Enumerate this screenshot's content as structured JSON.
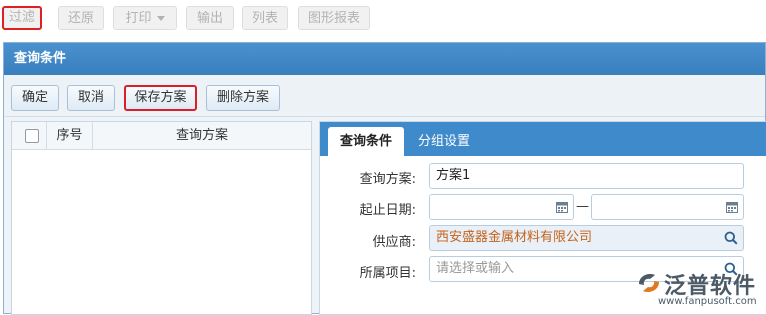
{
  "toolbar": {
    "filter": "过滤",
    "restore": "还原",
    "print": "打印",
    "export": "输出",
    "list": "列表",
    "chart_report": "图形报表"
  },
  "dialog": {
    "title": "查询条件",
    "buttons": {
      "confirm": "确定",
      "cancel": "取消",
      "save_scheme": "保存方案",
      "delete_scheme": "删除方案"
    },
    "scheme_table": {
      "columns": [
        "序号",
        "查询方案"
      ]
    },
    "tabs": {
      "conditions": "查询条件",
      "grouping": "分组设置"
    },
    "form": {
      "scheme_label": "查询方案:",
      "scheme_value": "方案1",
      "date_label": "起止日期:",
      "date_separator": "—",
      "supplier_label": "供应商:",
      "supplier_value": "西安盛器金属材料有限公司",
      "project_label": "所属项目:",
      "project_placeholder": "请选择或输入"
    }
  },
  "watermark": {
    "brand": "泛普软件",
    "url": "www.fanpusoft.com"
  },
  "colors": {
    "header_blue": "#3f8acb",
    "highlight_red": "#d7202a",
    "supplier_text": "#c4631c"
  }
}
